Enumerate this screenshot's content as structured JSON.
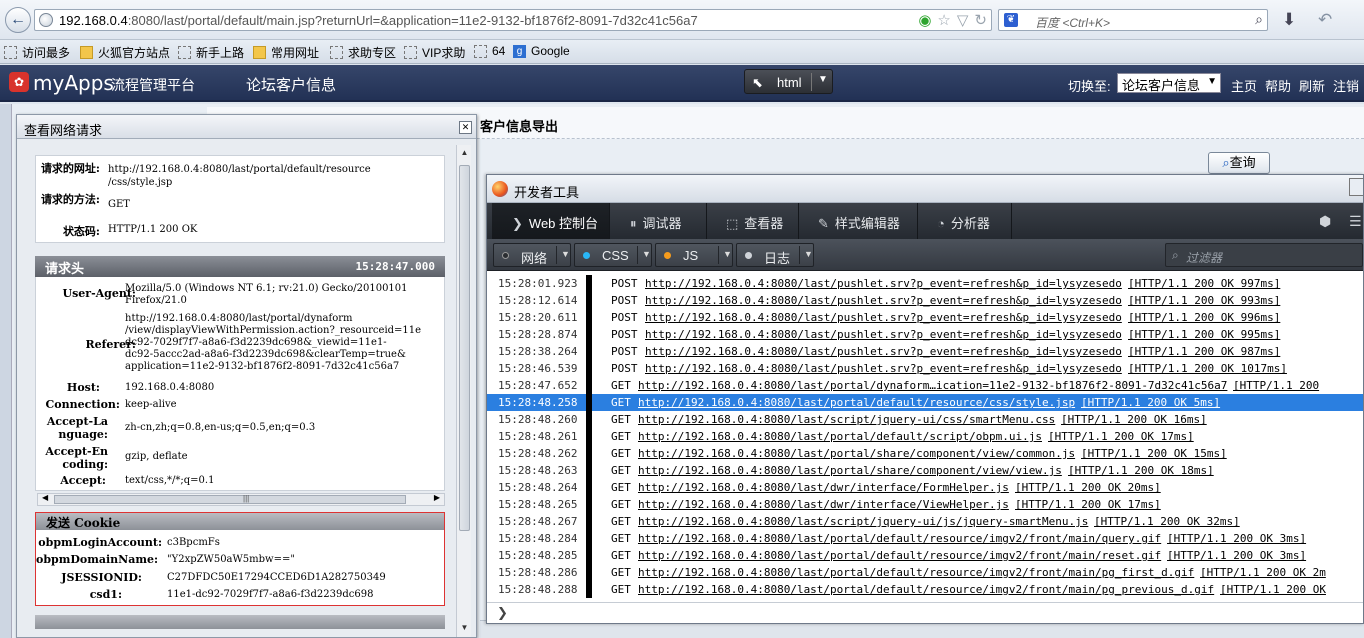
{
  "browser": {
    "url_host": "192.168.0.4",
    "url_rest": ":8080/last/portal/default/main.jsp?returnUrl=&application=11e2-9132-bf1876f2-8091-7d32c41c56a7",
    "search_placeholder": "百度 <Ctrl+K>",
    "bookmarks": [
      {
        "label": "访问最多",
        "icon": "most-visited-icon"
      },
      {
        "label": "火狐官方站点",
        "icon": "folder-icon"
      },
      {
        "label": "新手上路",
        "icon": "page-icon"
      },
      {
        "label": "常用网址",
        "icon": "folder-icon"
      },
      {
        "label": "求助专区",
        "icon": "page-icon"
      },
      {
        "label": "VIP求助",
        "icon": "page-icon"
      },
      {
        "label": "64",
        "icon": "page-icon"
      },
      {
        "label": "Google",
        "icon": "google-icon"
      }
    ]
  },
  "app": {
    "logo": "myApps",
    "logo_sub": "流程管理平台",
    "title": "论坛客户信息",
    "toggle_label": "html",
    "switch_label": "切换至:",
    "switch_value": "论坛客户信息",
    "nav": [
      "主页",
      "帮助",
      "刷新",
      "注销"
    ],
    "page_heading": "客户信息导出",
    "query_label": "查询"
  },
  "net_dialog": {
    "title": "查看网络请求",
    "request": {
      "url_label": "请求的网址:",
      "url_value": [
        "http://192.168.0.4:8080/last/portal/default/resource",
        "/css/style.jsp"
      ],
      "method_label": "请求的方法:",
      "method_value": "GET",
      "status_label": "状态码:",
      "status_value": "HTTP/1.1 200 OK"
    },
    "request_headers_title": "请求头",
    "request_headers_time": "15:28:47.000",
    "headers": [
      {
        "key": "User-Agent:",
        "lines": [
          "Mozilla/5.0 (Windows NT 6.1; rv:21.0) Gecko/20100101",
          "Firefox/21.0"
        ]
      },
      {
        "key": "Referer:",
        "lines": [
          "http://192.168.0.4:8080/last/portal/dynaform",
          "/view/displayViewWithPermission.action?_resourceid=11e",
          "dc92-7029f7f7-a8a6-f3d2239dc698&_viewid=11e1-",
          "dc92-5accc2ad-a8a6-f3d2239dc698&clearTemp=true&",
          "application=11e2-9132-bf1876f2-8091-7d32c41c56a7"
        ]
      },
      {
        "key": "Host:",
        "lines": [
          "192.168.0.4:8080"
        ]
      },
      {
        "key": "Connection:",
        "lines": [
          "keep-alive"
        ]
      },
      {
        "key": "Accept-Language:",
        "lines": [
          "zh-cn,zh;q=0.8,en-us;q=0.5,en;q=0.3"
        ]
      },
      {
        "key": "Accept-Encoding:",
        "lines": [
          "gzip, deflate"
        ]
      },
      {
        "key": "Accept:",
        "lines": [
          "text/css,*/*;q=0.1"
        ]
      }
    ],
    "cookie_title": "发送 Cookie",
    "cookies": [
      {
        "key": "obpmLoginAccount:",
        "value": "c3BpcmFs"
      },
      {
        "key": "obpmDomainName:",
        "value": "\"Y2xpZW50aW5mbw==\""
      },
      {
        "key": "JSESSIONID:",
        "value": "C27DFDC50E17294CCED6D1A282750349"
      },
      {
        "key": "csd1:",
        "value": "11e1-dc92-7029f7f7-a8a6-f3d2239dc698"
      }
    ]
  },
  "devtools": {
    "title": "开发者工具",
    "tabs": [
      "Web 控制台",
      "调试器",
      "查看器",
      "样式编辑器",
      "分析器"
    ],
    "filters": [
      {
        "label": "网络",
        "color": "#2a2d31"
      },
      {
        "label": "CSS",
        "color": "#29b6f6"
      },
      {
        "label": "JS",
        "color": "#f59b1c"
      },
      {
        "label": "日志",
        "color": "#cfd3d8"
      }
    ],
    "filter_placeholder": "过滤器",
    "selected_index": 7,
    "logs": [
      {
        "time": "15:28:01.923",
        "method": "POST",
        "url": "http://192.168.0.4:8080/last/pushlet.srv?p_event=refresh&p_id=lysyzesedo",
        "status": "[HTTP/1.1 200 OK 997ms]"
      },
      {
        "time": "15:28:12.614",
        "method": "POST",
        "url": "http://192.168.0.4:8080/last/pushlet.srv?p_event=refresh&p_id=lysyzesedo",
        "status": "[HTTP/1.1 200 OK 993ms]"
      },
      {
        "time": "15:28:20.611",
        "method": "POST",
        "url": "http://192.168.0.4:8080/last/pushlet.srv?p_event=refresh&p_id=lysyzesedo",
        "status": "[HTTP/1.1 200 OK 996ms]"
      },
      {
        "time": "15:28:28.874",
        "method": "POST",
        "url": "http://192.168.0.4:8080/last/pushlet.srv?p_event=refresh&p_id=lysyzesedo",
        "status": "[HTTP/1.1 200 OK 995ms]"
      },
      {
        "time": "15:28:38.264",
        "method": "POST",
        "url": "http://192.168.0.4:8080/last/pushlet.srv?p_event=refresh&p_id=lysyzesedo",
        "status": "[HTTP/1.1 200 OK 987ms]"
      },
      {
        "time": "15:28:46.539",
        "method": "POST",
        "url": "http://192.168.0.4:8080/last/pushlet.srv?p_event=refresh&p_id=lysyzesedo",
        "status": "[HTTP/1.1 200 OK 1017ms]"
      },
      {
        "time": "15:28:47.652",
        "method": "GET",
        "url": "http://192.168.0.4:8080/last/portal/dynaform…ication=11e2-9132-bf1876f2-8091-7d32c41c56a7",
        "status": "[HTTP/1.1 200"
      },
      {
        "time": "15:28:48.258",
        "method": "GET",
        "url": "http://192.168.0.4:8080/last/portal/default/resource/css/style.jsp",
        "status": "[HTTP/1.1 200 OK 5ms]"
      },
      {
        "time": "15:28:48.260",
        "method": "GET",
        "url": "http://192.168.0.4:8080/last/script/jquery-ui/css/smartMenu.css",
        "status": "[HTTP/1.1 200 OK 16ms]"
      },
      {
        "time": "15:28:48.261",
        "method": "GET",
        "url": "http://192.168.0.4:8080/last/portal/default/script/obpm.ui.js",
        "status": "[HTTP/1.1 200 OK 17ms]"
      },
      {
        "time": "15:28:48.262",
        "method": "GET",
        "url": "http://192.168.0.4:8080/last/portal/share/component/view/common.js",
        "status": "[HTTP/1.1 200 OK 15ms]"
      },
      {
        "time": "15:28:48.263",
        "method": "GET",
        "url": "http://192.168.0.4:8080/last/portal/share/component/view/view.js",
        "status": "[HTTP/1.1 200 OK 18ms]"
      },
      {
        "time": "15:28:48.264",
        "method": "GET",
        "url": "http://192.168.0.4:8080/last/dwr/interface/FormHelper.js",
        "status": "[HTTP/1.1 200 OK 20ms]"
      },
      {
        "time": "15:28:48.265",
        "method": "GET",
        "url": "http://192.168.0.4:8080/last/dwr/interface/ViewHelper.js",
        "status": "[HTTP/1.1 200 OK 17ms]"
      },
      {
        "time": "15:28:48.267",
        "method": "GET",
        "url": "http://192.168.0.4:8080/last/script/jquery-ui/js/jquery-smartMenu.js",
        "status": "[HTTP/1.1 200 OK 32ms]"
      },
      {
        "time": "15:28:48.284",
        "method": "GET",
        "url": "http://192.168.0.4:8080/last/portal/default/resource/imgv2/front/main/query.gif",
        "status": "[HTTP/1.1 200 OK 3ms]"
      },
      {
        "time": "15:28:48.285",
        "method": "GET",
        "url": "http://192.168.0.4:8080/last/portal/default/resource/imgv2/front/main/reset.gif",
        "status": "[HTTP/1.1 200 OK 3ms]"
      },
      {
        "time": "15:28:48.286",
        "method": "GET",
        "url": "http://192.168.0.4:8080/last/portal/default/resource/imgv2/front/main/pg_first_d.gif",
        "status": "[HTTP/1.1 200 OK 2m"
      },
      {
        "time": "15:28:48.288",
        "method": "GET",
        "url": "http://192.168.0.4:8080/last/portal/default/resource/imgv2/front/main/pg_previous_d.gif",
        "status": "[HTTP/1.1 200 OK"
      }
    ]
  }
}
